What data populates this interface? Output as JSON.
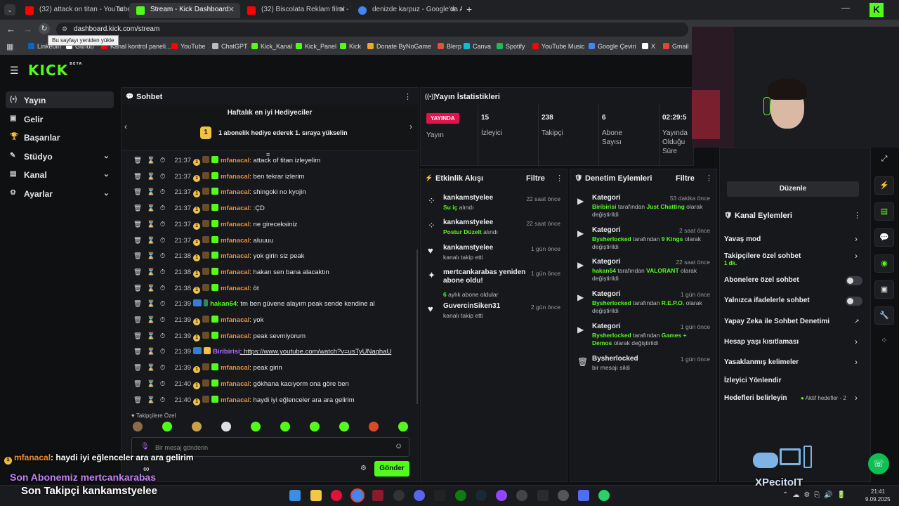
{
  "browser": {
    "tabs": [
      {
        "label": "(32) attack on titan - YouTube",
        "color": "#ff0000"
      },
      {
        "label": "Stream - Kick Dashboard",
        "color": "#53fc18"
      },
      {
        "label": "(32) Biscolata Reklam filmi - Yo",
        "color": "#ff0000"
      },
      {
        "label": "denizde karpuz - Google'da Ara",
        "color": "#4285f4"
      }
    ],
    "url": "dashboard.kick.com/stream",
    "reload_tooltip": "Bu sayfayı yeniden yükle",
    "bookmarks": [
      {
        "label": "LinkedIn",
        "color": "#0a66c2"
      },
      {
        "label": "Github",
        "color": "#ffffff"
      },
      {
        "label": "Kanal kontrol paneli...",
        "color": "#ff0000"
      },
      {
        "label": "YouTube",
        "color": "#ff0000"
      },
      {
        "label": "ChatGPT",
        "color": "#bbbbbb"
      },
      {
        "label": "Kick_Kanal",
        "color": "#53fc18"
      },
      {
        "label": "Kick_Panel",
        "color": "#53fc18"
      },
      {
        "label": "Kick",
        "color": "#53fc18"
      },
      {
        "label": "Donate ByNoGame",
        "color": "#f5a623"
      },
      {
        "label": "Blerp",
        "color": "#e84d3d"
      },
      {
        "label": "Canva",
        "color": "#00c4cc"
      },
      {
        "label": "Spotify",
        "color": "#1db954"
      },
      {
        "label": "YouTube Music",
        "color": "#ff0000"
      },
      {
        "label": "Google Çeviri",
        "color": "#4285f4"
      },
      {
        "label": "X",
        "color": "#ffffff"
      },
      {
        "label": "Gmail",
        "color": "#ea4335"
      }
    ]
  },
  "app": {
    "logo": "KICK",
    "logo_beta": "BETA",
    "sidebar": [
      {
        "label": "Yayın",
        "icon": "broadcast-icon",
        "active": true
      },
      {
        "label": "Gelir",
        "icon": "wallet-icon"
      },
      {
        "label": "Başarılar",
        "icon": "trophy-icon"
      },
      {
        "label": "Stüdyo",
        "icon": "studio-icon",
        "expand": true
      },
      {
        "label": "Kanal",
        "icon": "channel-icon",
        "expand": true
      },
      {
        "label": "Ayarlar",
        "icon": "gear-icon",
        "expand": true
      }
    ]
  },
  "chat": {
    "title": "Sohbet",
    "gifters_title": "Haftalık en iyi Hediyeciler",
    "gifters_hint": "1 abonelik hediye ederek 1. sıraya yükselin",
    "gifters_rank": "1",
    "messages": [
      {
        "time": "21:37",
        "user": "mfanacal",
        "text": ": attack of titan izleyelim",
        "kind": "o"
      },
      {
        "time": "21:37",
        "user": "mfanacal",
        "text": ": ben tekrar izlerim",
        "kind": "o"
      },
      {
        "time": "21:37",
        "user": "mfanacal",
        "text": ": shingoki no kyojin",
        "kind": "o"
      },
      {
        "time": "21:37",
        "user": "mfanacal",
        "text": ": :ÇD",
        "kind": "o"
      },
      {
        "time": "21:37",
        "user": "mfanacal",
        "text": ": ne gireceksiniz",
        "kind": "o"
      },
      {
        "time": "21:37",
        "user": "mfanacal",
        "text": ": aluuuu",
        "kind": "o"
      },
      {
        "time": "21:38",
        "user": "mfanacal",
        "text": ": yok girin siz peak",
        "kind": "o"
      },
      {
        "time": "21:38",
        "user": "mfanacal",
        "text": ": hakan sen bana alacaktın",
        "kind": "o"
      },
      {
        "time": "21:38",
        "user": "mfanacal",
        "text": ": öt",
        "kind": "o"
      },
      {
        "time": "21:39",
        "user": "hakan64",
        "text": ": tm ben güvene alayım peak sende kendine al",
        "kind": "g"
      },
      {
        "time": "21:39",
        "user": "mfanacal",
        "text": ": yok",
        "kind": "o"
      },
      {
        "time": "21:39",
        "user": "mfanacal",
        "text": ": peak sevmiyorum",
        "kind": "o"
      },
      {
        "time": "21:39",
        "user": "Biribirisi",
        "text": ": https://www.youtube.com/watch?v=usTyUNaghaU",
        "kind": "p"
      },
      {
        "time": "21:39",
        "user": "mfanacal",
        "text": ": peak girin",
        "kind": "o"
      },
      {
        "time": "21:40",
        "user": "mfanacal",
        "text": ": gökhana kacıyorm ona göre ben",
        "kind": "o"
      },
      {
        "time": "21:40",
        "user": "mfanacal",
        "text": ": haydi iyi eğlenceler ara ara gelirim",
        "kind": "o"
      }
    ],
    "followers_label": "Takipçilere Özel",
    "input_placeholder": "Bir mesaj gönderin",
    "send_label": "Gönder"
  },
  "stats": {
    "title": "Yayın İstatistikleri",
    "live_badge": "YAYINDA",
    "live_caption": "Yayın",
    "items": [
      {
        "value": "15",
        "label": "İzleyici"
      },
      {
        "value": "238",
        "label": "Takipçi"
      },
      {
        "value": "6",
        "label": "Abone Sayısı"
      },
      {
        "value": "02:29:5",
        "label": "Yayında Olduğu Süre"
      }
    ]
  },
  "activity": {
    "title": "Etkinlik Akışı",
    "filter": "Filtre",
    "events": [
      {
        "name": "kankamstyelee",
        "sub_green": "Su iç",
        "sub": " alındı",
        "time": "22 saat önce",
        "icon": "points-icon"
      },
      {
        "name": "kankamstyelee",
        "sub_green": "Postur Düzelt",
        "sub": " alındı",
        "time": "22 saat önce",
        "icon": "points-icon"
      },
      {
        "name": "kankamstyelee",
        "sub_green": "",
        "sub": "kanalı takip etti",
        "time": "1 gün önce",
        "icon": "heart-icon"
      },
      {
        "name": "mertcankarabas yeniden abone oldu!",
        "sub_green": "6",
        "sub": " aylık abone oldular",
        "time": "1 gün önce",
        "icon": "sparkle-icon"
      },
      {
        "name": "GuvercinSiken31",
        "sub_green": "",
        "sub": "kanalı takip etti",
        "time": "2 gün önce",
        "icon": "heart-icon"
      }
    ]
  },
  "moderation": {
    "title": "Denetim Eylemleri",
    "filter": "Filtre",
    "events": [
      {
        "name": "Kategori",
        "actor": "Biribirisi",
        "mid": " tarafından ",
        "target": "Just Chatting",
        "tail": " olarak değiştirildi",
        "time": "53 dakika önce"
      },
      {
        "name": "Kategori",
        "actor": "Bysherlocked",
        "mid": " tarafından ",
        "target": "9 Kings",
        "tail": " olarak değiştirildi",
        "time": "2 saat önce"
      },
      {
        "name": "Kategori",
        "actor": "hakan64",
        "mid": " tarafından ",
        "target": "VALORANT",
        "tail": " olarak değiştirildi",
        "time": "22 saat önce"
      },
      {
        "name": "Kategori",
        "actor": "Bysherlocked",
        "mid": " tarafından ",
        "target": "R.E.P.O.",
        "tail": " olarak değiştirildi",
        "time": "1 gün önce"
      },
      {
        "name": "Kategori",
        "actor": "Bysherlocked",
        "mid": " tarafından ",
        "target": "Games + Demos",
        "tail": " olarak değiştirildi",
        "time": "1 gün önce"
      },
      {
        "name": "Bysherlocked",
        "actor": "",
        "mid": "bir mesajı sildi",
        "target": "",
        "tail": "",
        "time": "1 gün önce"
      }
    ]
  },
  "channel_actions": {
    "edit_label": "Düzenle",
    "title": "Kanal Eylemleri",
    "items": [
      {
        "label": "Yavaş mod",
        "control": "chevron"
      },
      {
        "label": "Takipçilere özel sohbet",
        "extra": "1 dk.",
        "control": "chevron"
      },
      {
        "label": "Abonelere özel sohbet",
        "control": "toggle"
      },
      {
        "label": "Yalnızca ifadelerle sohbet",
        "control": "toggle"
      },
      {
        "label": "Yapay Zeka ile Sohbet Denetimi",
        "control": "external"
      },
      {
        "label": "Hesap yaşı kısıtlaması",
        "control": "chevron"
      },
      {
        "label": "Yasaklanmış kelimeler",
        "control": "chevron"
      },
      {
        "label": "İzleyici Yönlendir",
        "control": "none"
      },
      {
        "label": "Hedefleri belirleyin",
        "extra": "Aktif hedefler - 2",
        "control": "chevron"
      }
    ]
  },
  "overlay": {
    "chat_user": "mfanacal",
    "chat_text": ": haydi iyi eğlenceler ara ara gelirim",
    "last_sub": "Son Abonemiz mertcankarabas",
    "last_follow": "Son Takipçi kankamstyelee",
    "brand": "XPecitoIT",
    "infinity": "∞"
  },
  "taskbar": {
    "time": "21:41",
    "date": "9.09.2025"
  }
}
